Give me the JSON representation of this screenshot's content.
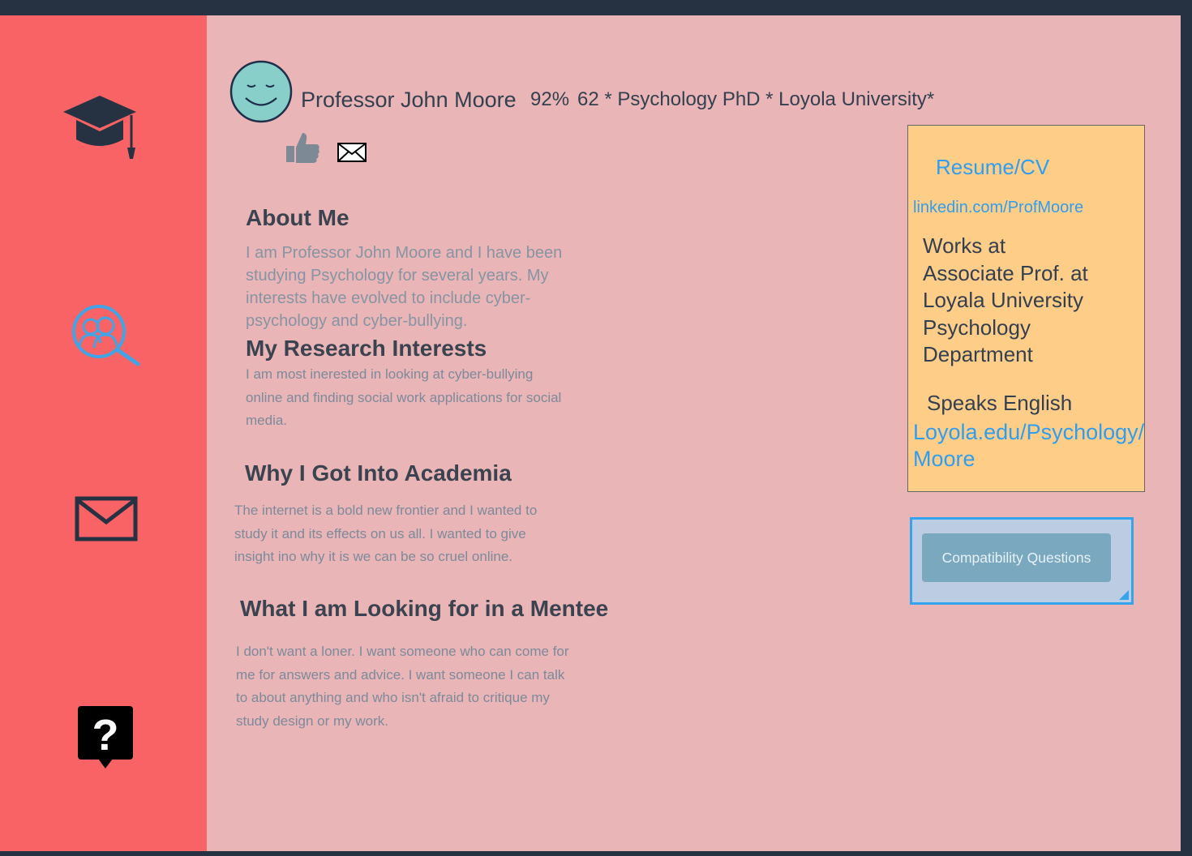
{
  "sidebar": {
    "items": [
      {
        "icon": "graduation-cap-icon"
      },
      {
        "icon": "search-people-icon"
      },
      {
        "icon": "mail-icon"
      },
      {
        "icon": "help-icon"
      }
    ]
  },
  "profile": {
    "avatar_icon": "smiley-face-icon",
    "name": "Professor John Moore",
    "match_percent": "92%",
    "details": "62 * Psychology PhD * Loyola University*",
    "actions": [
      {
        "icon": "thumbs-up-icon"
      },
      {
        "icon": "envelope-icon"
      }
    ]
  },
  "about": {
    "heading": "About Me",
    "text": "I am Professor John Moore and I have been studying Psychology for several years. My interests have evolved to include cyber-psychology and cyber-bullying."
  },
  "research": {
    "heading": "My Research Interests",
    "text": "I am most inerested in looking at cyber-bullying online and finding social work applications for social media."
  },
  "academia": {
    "heading": "Why I Got Into Academia",
    "text": "The internet is a bold new frontier and I wanted to study it and its effects on us all. I wanted to give insight ino why it is we can be so cruel online."
  },
  "mentee": {
    "heading": "What I am Looking for in a Mentee",
    "text": "I don't want a loner. I want someone who can come for me for answers and advice. I want someone I can talk to about anything and who isn't afraid to critique my study design or my work."
  },
  "infobox": {
    "resume_link": "Resume/CV",
    "linkedin_link": "linkedin.com/ProfMoore",
    "works_lines": [
      "Works at",
      "Associate Prof. at",
      "Loyala University",
      "Psychology",
      "Department"
    ],
    "speaks": "Speaks English",
    "website_lines": [
      "Loyola.edu/Psychology/",
      "Moore"
    ]
  },
  "compatibility": {
    "button_label": "Compatibility Questions"
  },
  "colors": {
    "sidebar": "#f96366",
    "main": "#e9b5b6",
    "infobox": "#fecd88",
    "link": "#2f9ef0",
    "accent": "#36a4ec"
  }
}
